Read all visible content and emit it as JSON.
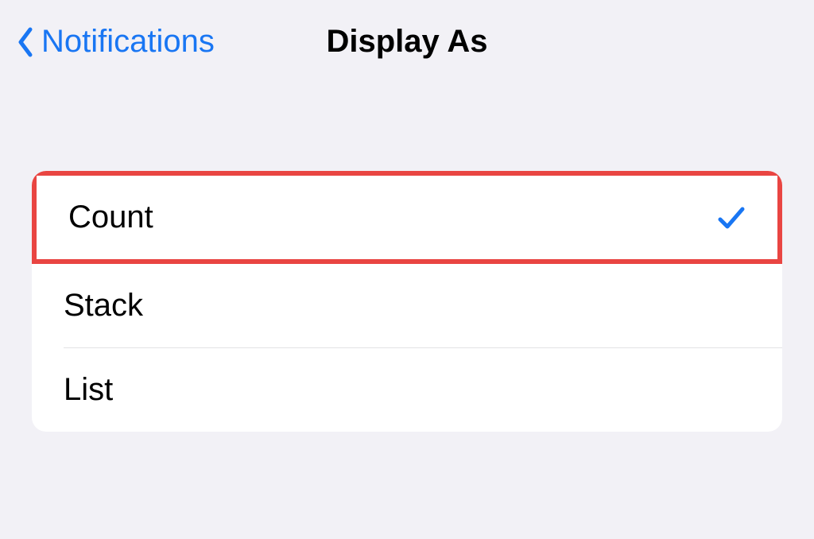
{
  "header": {
    "back_label": "Notifications",
    "title": "Display As"
  },
  "options": {
    "items": [
      {
        "label": "Count",
        "selected": true,
        "highlighted": true
      },
      {
        "label": "Stack",
        "selected": false,
        "highlighted": false
      },
      {
        "label": "List",
        "selected": false,
        "highlighted": false
      }
    ]
  }
}
